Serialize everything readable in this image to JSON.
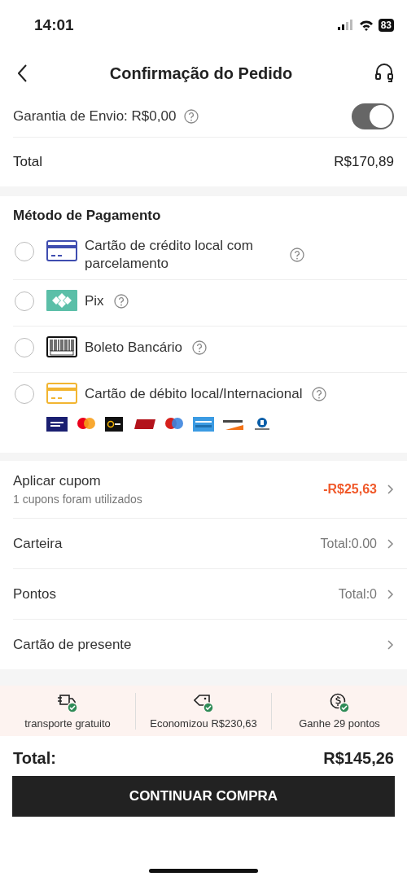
{
  "status_bar": {
    "time": "14:01",
    "battery": "83"
  },
  "header": {
    "title": "Confirmação do Pedido"
  },
  "shipping_guarantee": {
    "label": "Garantia de Envio: R$0,00",
    "on": true
  },
  "subtotal": {
    "label": "Total",
    "value": "R$170,89"
  },
  "payment": {
    "title": "Método de Pagamento",
    "methods": [
      {
        "kind": "credit",
        "label": "Cartão de crédito local com parcelamento",
        "selected": false
      },
      {
        "kind": "pix",
        "label": "Pix",
        "selected": false
      },
      {
        "kind": "boleto",
        "label": "Boleto Bancário",
        "selected": false
      },
      {
        "kind": "debit",
        "label": "Cartão de débito local/Internacional",
        "selected": false
      }
    ]
  },
  "options": [
    {
      "kind": "discount",
      "label": "Aplicar cupom",
      "sublabel": "1 cupons foram utilizados",
      "value": "-R$25,63"
    },
    {
      "kind": "plain",
      "label": "Carteira",
      "value": "Total:0.00"
    },
    {
      "kind": "plain",
      "label": "Pontos",
      "value": "Total:0"
    },
    {
      "kind": "plain",
      "label": "Cartão de presente"
    }
  ],
  "benefits": [
    {
      "kind": "truck",
      "text": "transporte gratuito"
    },
    {
      "kind": "tag",
      "text": "Economizou R$230,63"
    },
    {
      "kind": "coin",
      "text": "Ganhe 29 pontos"
    }
  ],
  "footer": {
    "total_label": "Total:",
    "total_value": "R$145,26",
    "button": "CONTINUAR COMPRA"
  }
}
